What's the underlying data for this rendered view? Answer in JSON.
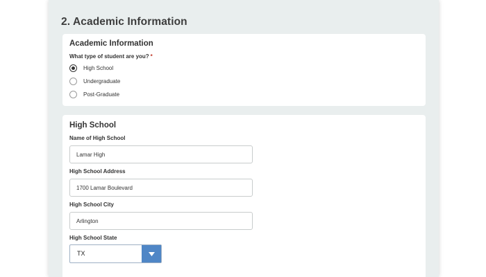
{
  "section_heading": "2. Academic Information",
  "academic_card": {
    "title": "Academic Information",
    "question": "What type of student are you?",
    "required_mark": "*",
    "options": [
      {
        "label": "High School",
        "selected": true
      },
      {
        "label": "Undergraduate",
        "selected": false
      },
      {
        "label": "Post-Graduate",
        "selected": false
      }
    ]
  },
  "high_school_card": {
    "title": "High School",
    "name_field": {
      "label": "Name of High School",
      "value": "Lamar High"
    },
    "address_field": {
      "label": "High School Address",
      "value": "1700 Lamar Boulevard"
    },
    "city_field": {
      "label": "High School City",
      "value": "Arlington"
    },
    "state_field": {
      "label": "High School State",
      "value": "TX"
    }
  },
  "icons": {
    "radio_checked": "radio-checked-icon",
    "radio_unchecked": "radio-unchecked-icon",
    "select_toggle": "chevron-down-icon"
  },
  "colors": {
    "page_background": "#e9eeee",
    "card_background": "#ffffff",
    "select_accent": "#4f86c6",
    "required": "#c0392b"
  }
}
